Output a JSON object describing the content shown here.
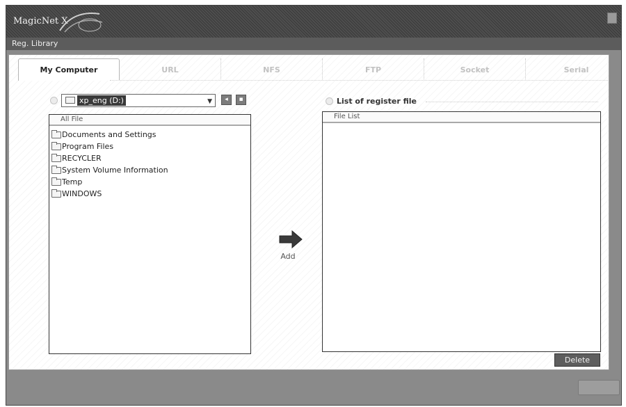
{
  "app": {
    "title": "MagicNet X"
  },
  "menu": {
    "items": [
      {
        "label": "Reg. Library"
      }
    ]
  },
  "tabs": [
    {
      "label": "My Computer",
      "active": true
    },
    {
      "label": "URL",
      "active": false
    },
    {
      "label": "NFS",
      "active": false
    },
    {
      "label": "FTP",
      "active": false
    },
    {
      "label": "Socket",
      "active": false
    },
    {
      "label": "Serial",
      "active": false
    }
  ],
  "left": {
    "drive_value": "xp_eng (D:)",
    "list_header": "All File",
    "items": [
      "Documents and Settings",
      "Program Files",
      "RECYCLER",
      "System Volume Information",
      "Temp",
      "WINDOWS"
    ]
  },
  "middle": {
    "add_label": "Add"
  },
  "right": {
    "title": "List of register file",
    "list_header": "File List",
    "delete_label": "Delete"
  },
  "colors": {
    "window_frame": "#8a8a8a",
    "titlebar": "#444444",
    "menubar": "#5c5c5c",
    "selection": "#3a3a3a",
    "button": "#5e5e5e"
  },
  "icons": {
    "drive": "drive-icon",
    "folder": "folder-icon",
    "arrow": "right-arrow-icon",
    "close": "close-icon"
  }
}
